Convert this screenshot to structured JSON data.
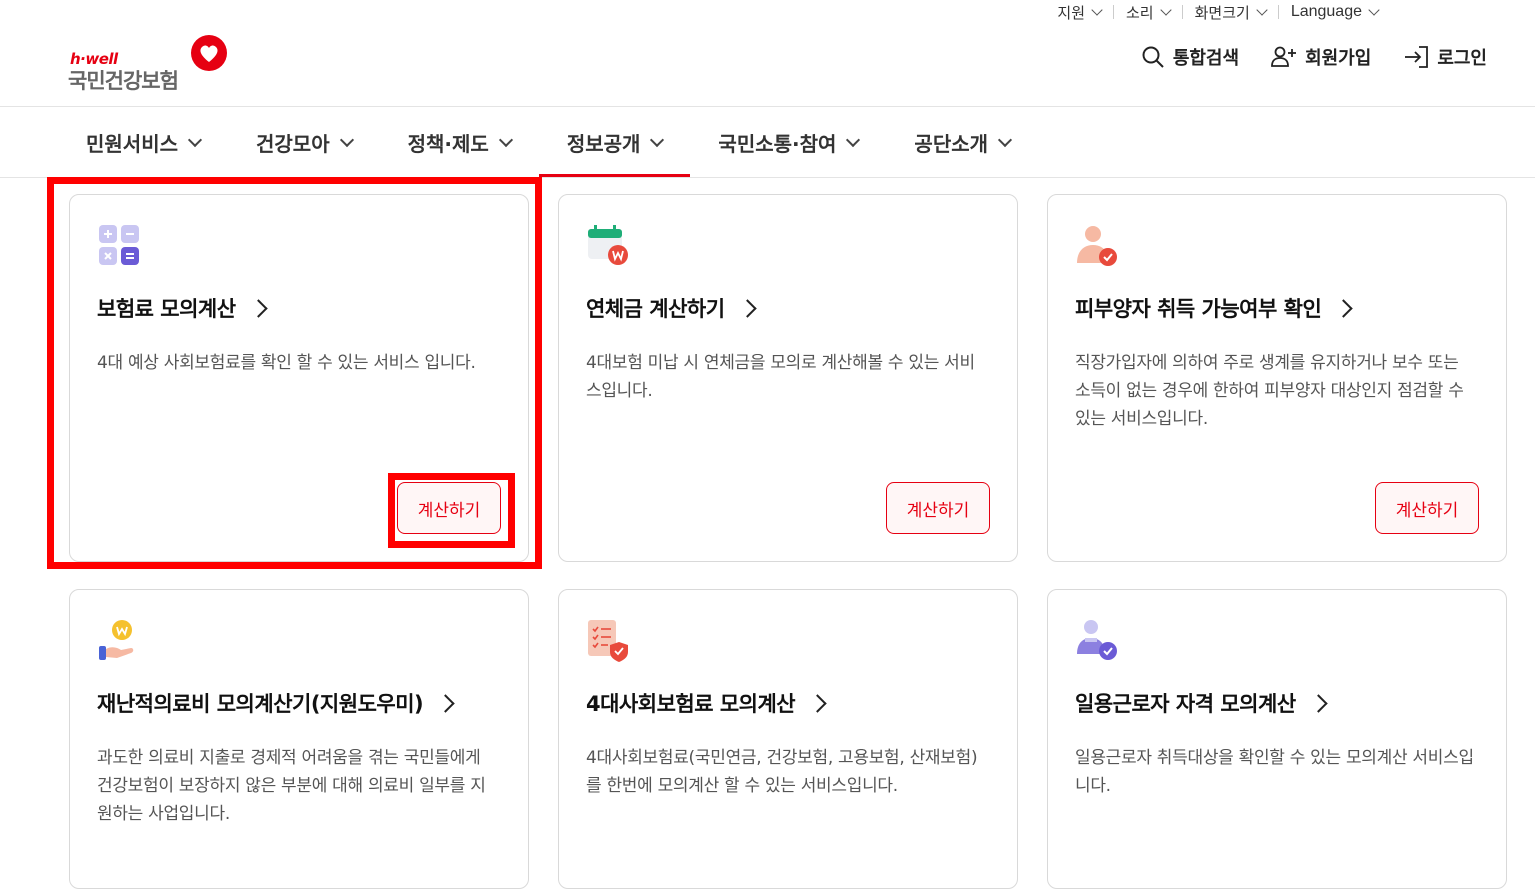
{
  "utility": {
    "support": "지원",
    "sound": "소리",
    "screen_size": "화면크기",
    "language": "Language"
  },
  "logo": {
    "brand": "h·well",
    "org": "국민건강보험"
  },
  "header": {
    "search": "통합검색",
    "signup": "회원가입",
    "login": "로그인"
  },
  "nav": [
    {
      "label": "민원서비스"
    },
    {
      "label": "건강모아"
    },
    {
      "label": "정책·제도"
    },
    {
      "label": "정보공개",
      "active": true
    },
    {
      "label": "국민소통·참여"
    },
    {
      "label": "공단소개"
    }
  ],
  "cards": [
    {
      "title": "보험료 모의계산",
      "desc": "4대 예상 사회보험료를 확인 할 수 있는 서비스 입니다.",
      "button": "계산하기",
      "icon": "calculator-icon"
    },
    {
      "title": "연체금 계산하기",
      "desc": "4대보험 미납 시 연체금을 모의로 계산해볼 수 있는 서비스입니다.",
      "button": "계산하기",
      "icon": "calendar-won-icon"
    },
    {
      "title": "피부양자 취득 가능여부 확인",
      "desc": "직장가입자에 의하여 주로 생계를 유지하거나 보수 또는 소득이 없는 경우에 한하여 피부양자 대상인지 점검할 수 있는 서비스입니다.",
      "button": "계산하기",
      "icon": "person-check-icon"
    },
    {
      "title": "재난적의료비 모의계산기(지원도우미)",
      "desc": "과도한 의료비 지출로 경제적 어려움을 겪는 국민들에게 건강보험이 보장하지 않은 부분에 대해 의료비 일부를 지원하는 사업입니다.",
      "icon": "hand-coin-icon"
    },
    {
      "title": "4대사회보험료 모의계산",
      "desc": "4대사회보험료(국민연금, 건강보험, 고용보험, 산재보험)를 한번에 모의계산 할 수 있는 서비스입니다.",
      "icon": "checklist-shield-icon"
    },
    {
      "title": "일용근로자 자격 모의계산",
      "desc": "일용근로자 취득대상을 확인할 수 있는 모의계산 서비스입니다.",
      "icon": "worker-check-icon"
    }
  ],
  "colors": {
    "accent": "#e60012",
    "highlight": "#ff0000"
  }
}
